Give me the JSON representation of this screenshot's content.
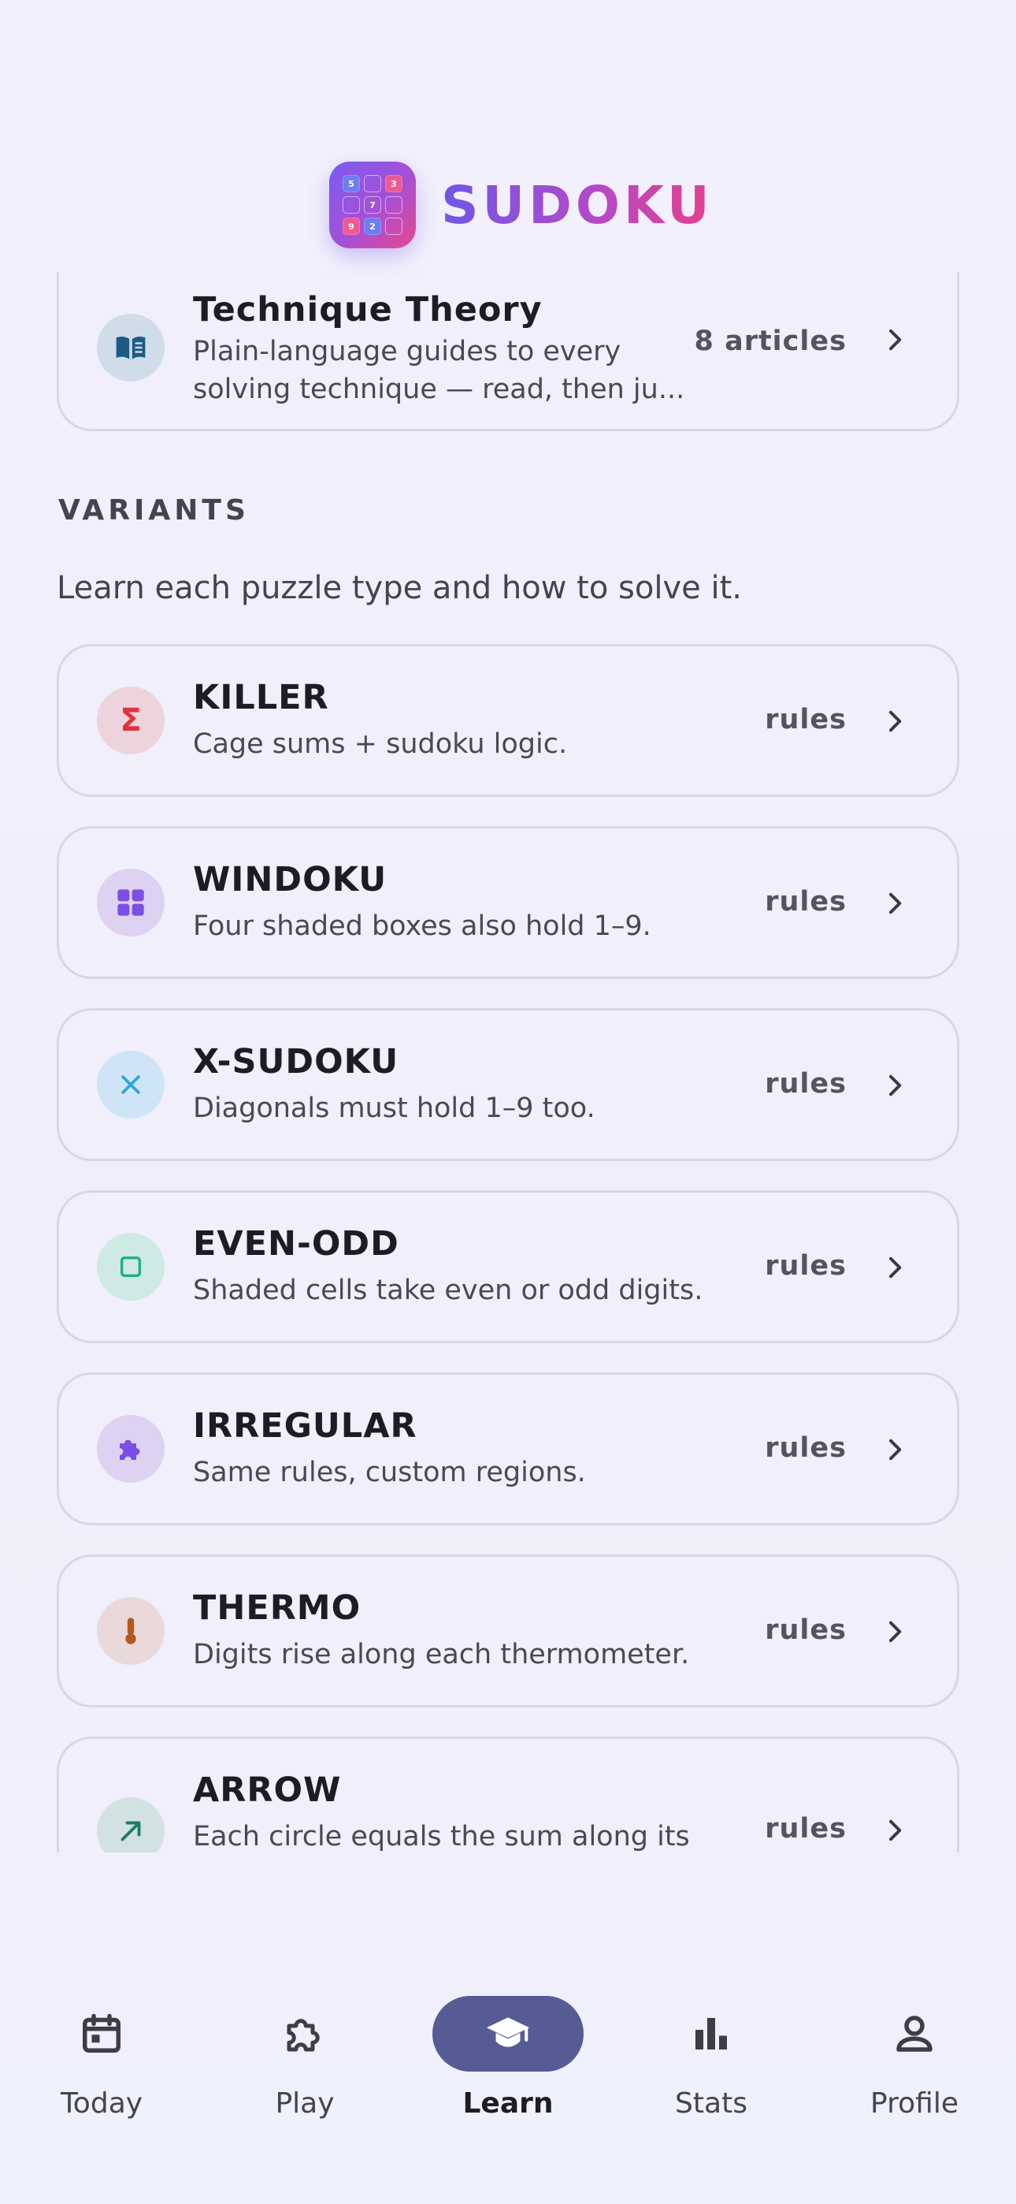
{
  "app": {
    "title": "SUDOKU",
    "icon_digits": [
      "5",
      "",
      "3",
      "",
      "7",
      "",
      "9",
      "2",
      ""
    ],
    "colors": {
      "accent_start": "#6e57e8",
      "accent_end": "#e63f8c",
      "nav_active": "#575b94"
    }
  },
  "technique": {
    "title": "Technique Theory",
    "subtitle_line1": "Plain-language guides to every",
    "subtitle_line2": "solving technique — read, then ju...",
    "meta": "8 articles",
    "icon": "book-icon"
  },
  "variants": {
    "section_label": "VARIANTS",
    "description": "Learn each puzzle type and how to solve it.",
    "items": [
      {
        "title": "KILLER",
        "subtitle": "Cage sums + sudoku logic.",
        "meta": "rules",
        "icon": "sigma-icon",
        "color": "#e0323e"
      },
      {
        "title": "WINDOKU",
        "subtitle": "Four shaded boxes also hold 1–9.",
        "meta": "rules",
        "icon": "grid-icon",
        "color": "#7c4ee6"
      },
      {
        "title": "X-SUDOKU",
        "subtitle": "Diagonals must hold 1–9 too.",
        "meta": "rules",
        "icon": "x-icon",
        "color": "#2aa6df"
      },
      {
        "title": "EVEN-ODD",
        "subtitle": "Shaded cells take even or odd digits.",
        "meta": "rules",
        "icon": "square-icon",
        "color": "#1fae8a"
      },
      {
        "title": "IRREGULAR",
        "subtitle": "Same rules, custom regions.",
        "meta": "rules",
        "icon": "puzzle-icon",
        "color": "#7c4ee6"
      },
      {
        "title": "THERMO",
        "subtitle": "Digits rise along each thermometer.",
        "meta": "rules",
        "icon": "thermometer-icon",
        "color": "#b45a1e"
      },
      {
        "title": "ARROW",
        "subtitle": "Each circle equals the sum along its",
        "meta": "rules",
        "icon": "arrow-icon",
        "color": "#1f7a6e"
      }
    ]
  },
  "nav": {
    "items": [
      {
        "label": "Today",
        "icon": "calendar-icon"
      },
      {
        "label": "Play",
        "icon": "puzzle-icon"
      },
      {
        "label": "Learn",
        "icon": "graduation-cap-icon",
        "active": true
      },
      {
        "label": "Stats",
        "icon": "bar-chart-icon"
      },
      {
        "label": "Profile",
        "icon": "person-icon"
      }
    ]
  }
}
